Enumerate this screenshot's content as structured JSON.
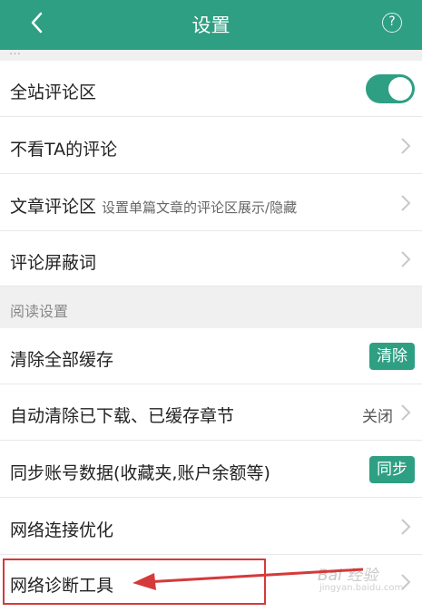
{
  "header": {
    "title": "设置",
    "back_icon": "chevron-left-icon",
    "help_icon": "question-circle-icon",
    "help_glyph": "?",
    "bg_color": "#2e9f83"
  },
  "partial_row_fragment": "…",
  "comment_rows": [
    {
      "label": "全站评论区",
      "control": "toggle",
      "toggle_on": true
    },
    {
      "label": "不看TA的评论",
      "control": "chevron"
    },
    {
      "label": "文章评论区",
      "sub": "设置单篇文章的评论区展示/隐藏",
      "control": "chevron"
    },
    {
      "label": "评论屏蔽词",
      "control": "chevron"
    }
  ],
  "reading_section": {
    "title": "阅读设置",
    "rows": [
      {
        "label": "清除全部缓存",
        "button": "清除"
      },
      {
        "label": "自动清除已下载、已缓存章节",
        "value": "关闭"
      },
      {
        "label": "同步账号数据(收藏夹,账户余额等)",
        "button": "同步"
      },
      {
        "label": "网络连接优化"
      },
      {
        "label": "网络诊断工具"
      }
    ]
  },
  "watermark": {
    "text": "Bai 经验",
    "sub": "jingyan.baidu.com"
  },
  "colors": {
    "accent": "#2e9f83",
    "annotation": "#d53a3a",
    "section_bg": "#f0f0f0"
  }
}
